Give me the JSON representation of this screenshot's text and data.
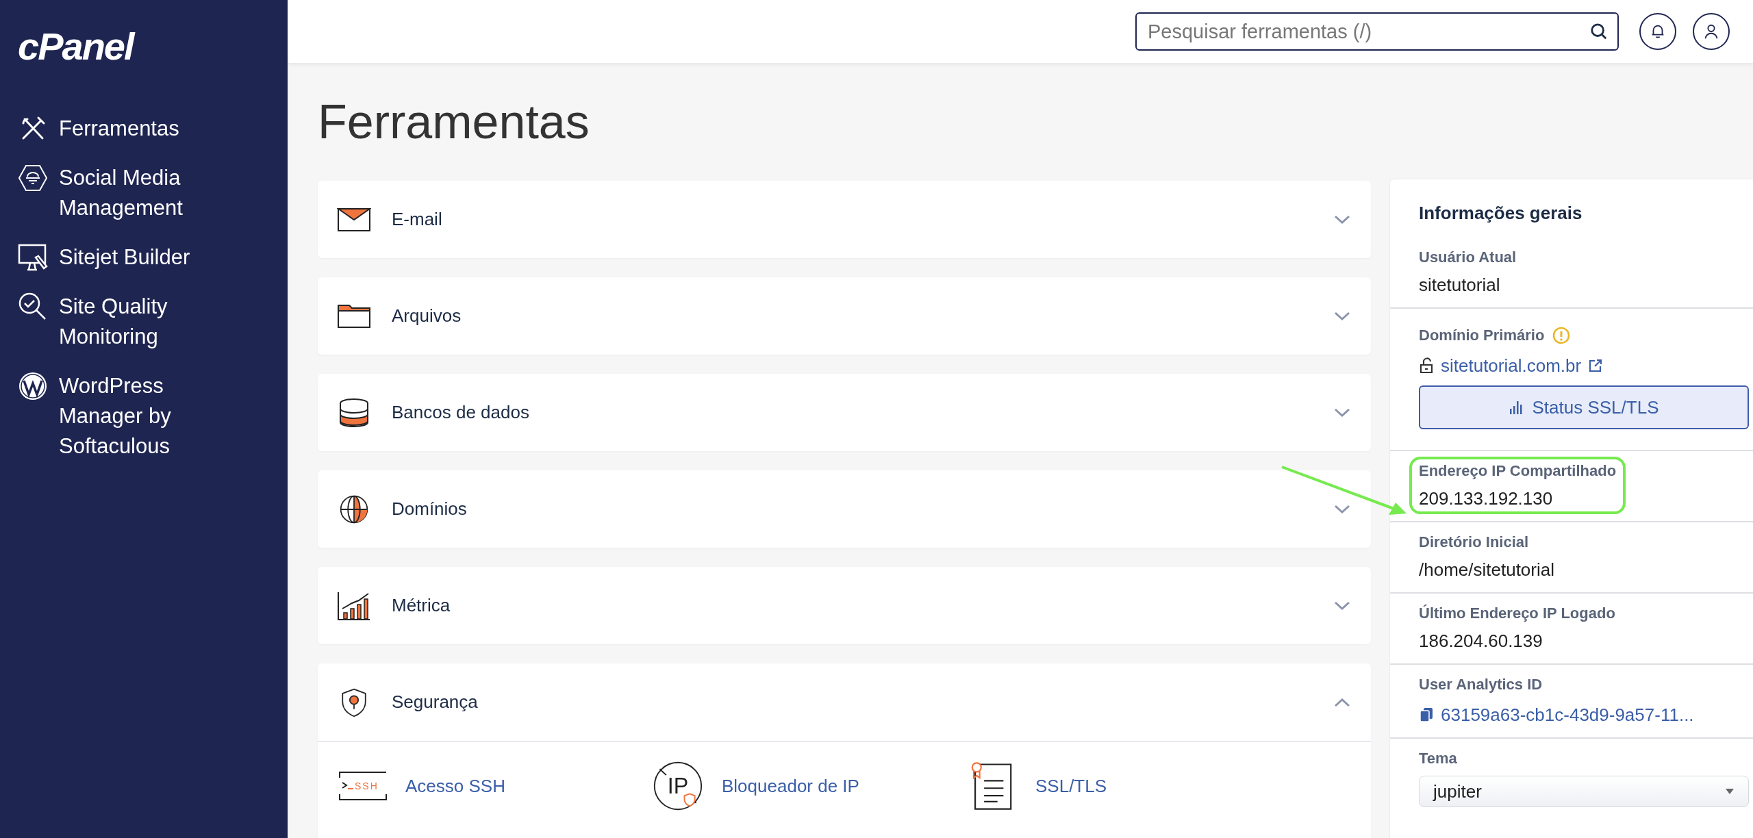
{
  "logo": "cPanel",
  "sidebar": {
    "items": [
      {
        "label": "Ferramentas"
      },
      {
        "label": "Social Media Management"
      },
      {
        "label": "Sitejet Builder"
      },
      {
        "label": "Site Quality Monitoring"
      },
      {
        "label": "WordPress Manager by Softaculous"
      }
    ]
  },
  "search": {
    "placeholder": "Pesquisar ferramentas (/)"
  },
  "page_title": "Ferramentas",
  "sections": [
    {
      "title": "E-mail",
      "expanded": false
    },
    {
      "title": "Arquivos",
      "expanded": false
    },
    {
      "title": "Bancos de dados",
      "expanded": false
    },
    {
      "title": "Domínios",
      "expanded": false
    },
    {
      "title": "Métrica",
      "expanded": false
    },
    {
      "title": "Segurança",
      "expanded": true,
      "items": [
        {
          "label": "Acesso SSH",
          "icon_text": "SSH"
        },
        {
          "label": "Bloqueador de IP",
          "icon_text": "IP"
        },
        {
          "label": "SSL/TLS"
        }
      ]
    }
  ],
  "info_panel": {
    "title": "Informações gerais",
    "items": [
      {
        "kind": "text",
        "label": "Usuário Atual",
        "value": "sitetutorial",
        "highlighted": false
      },
      {
        "kind": "domain",
        "label": "Domínio Primário",
        "warning": true,
        "value": "sitetutorial.com.br",
        "button": "Status SSL/TLS",
        "highlighted": false
      },
      {
        "kind": "text",
        "label": "Endereço IP Compartilhado",
        "value": "209.133.192.130",
        "highlighted": true
      },
      {
        "kind": "text",
        "label": "Diretório Inicial",
        "value": "/home/sitetutorial",
        "highlighted": false
      },
      {
        "kind": "text",
        "label": "Último Endereço IP Logado",
        "value": "186.204.60.139",
        "highlighted": false
      },
      {
        "kind": "copy",
        "label": "User Analytics ID",
        "value": "63159a63-cb1c-43d9-9a57-11...",
        "highlighted": false
      },
      {
        "kind": "select",
        "label": "Tema",
        "value": "jupiter",
        "highlighted": false
      }
    ]
  }
}
